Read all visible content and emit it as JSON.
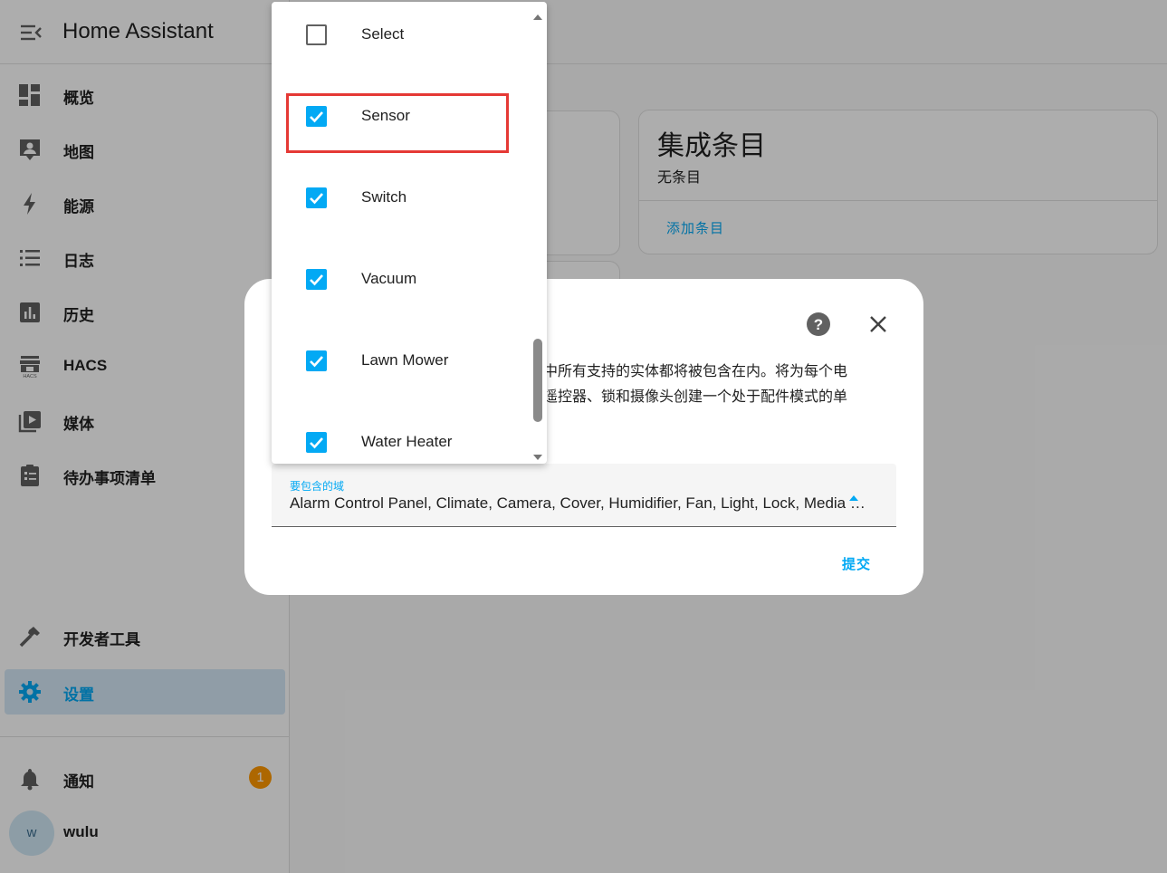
{
  "app": {
    "title": "Home Assistant"
  },
  "sidebar": {
    "items": [
      {
        "label": "概览",
        "icon": "dashboard-icon"
      },
      {
        "label": "地图",
        "icon": "map-icon"
      },
      {
        "label": "能源",
        "icon": "lightning-icon"
      },
      {
        "label": "日志",
        "icon": "list-icon"
      },
      {
        "label": "历史",
        "icon": "chart-icon"
      },
      {
        "label": "HACS",
        "icon": "hacs-icon"
      },
      {
        "label": "媒体",
        "icon": "media-icon"
      },
      {
        "label": "待办事项清单",
        "icon": "clipboard-icon"
      }
    ],
    "dev_tools": {
      "label": "开发者工具",
      "icon": "hammer-icon"
    },
    "settings": {
      "label": "设置",
      "icon": "gear-icon"
    },
    "notifications": {
      "label": "通知",
      "icon": "bell-icon",
      "badge": "1"
    },
    "user": {
      "name": "wulu",
      "initial": "w"
    }
  },
  "entries_card": {
    "title": "集成条目",
    "subtitle": "无条目",
    "action": "添加条目"
  },
  "dialog": {
    "description_line1": "中所有支持的实体都将被包含在内。将为每个电",
    "description_line2": "遥控器、锁和摄像头创建一个处于配件模式的单",
    "field_label": "要包含的域",
    "field_value": "Alarm Control Panel, Climate, Camera, Cover, Humidifier, Fan, Light, Lock, Media Player, Remote, Select, Sensor, Switch, Vacuum, Lawn Mower, Water Heater",
    "submit_label": "提交"
  },
  "menu": {
    "options": [
      {
        "label": "Select",
        "checked": false
      },
      {
        "label": "Sensor",
        "checked": true
      },
      {
        "label": "Switch",
        "checked": true
      },
      {
        "label": "Vacuum",
        "checked": true
      },
      {
        "label": "Lawn Mower",
        "checked": true
      },
      {
        "label": "Water Heater",
        "checked": true
      }
    ]
  },
  "colors": {
    "accent": "#03a9f4",
    "badge": "#ff9800",
    "highlight": "#e53935"
  }
}
